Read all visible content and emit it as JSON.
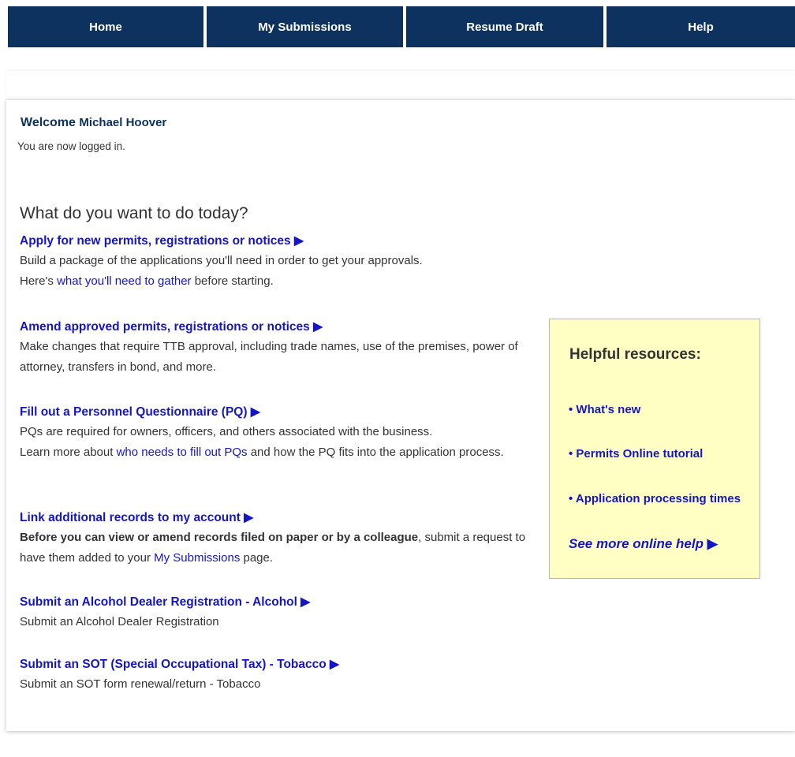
{
  "nav": {
    "home": "Home",
    "submissions": "My Submissions",
    "resume": "Resume Draft",
    "help": "Help"
  },
  "welcome": {
    "greeting": "Welcome",
    "name": "Michael Hoover",
    "status": "You are now logged in."
  },
  "headline": "What do you want to do today?",
  "arrow": "▶",
  "tasks": {
    "apply": {
      "title": "Apply for new permits, registrations or notices",
      "desc_a": "Build a package of the applications you'll need in order to get your approvals.",
      "desc_b": "Here's",
      "link": "what you'll need to gather",
      "desc_c": "before starting."
    },
    "amend": {
      "title": "Amend approved permits, registrations or notices",
      "desc": "Make changes that require TTB approval, including trade names, use of the premises, power of attorney, transfers in bond, and more."
    },
    "pq": {
      "title": "Fill out a Personnel Questionnaire (PQ)",
      "desc_a": "PQs are required for owners, officers, and others associated with the business.",
      "desc_b": "Learn more about",
      "link": "who needs to fill out PQs",
      "desc_c": "and how the PQ fits into the application process."
    },
    "link": {
      "title": "Link additional records to my account",
      "bold": "Before you can view or amend records filed on paper or by a colleague",
      "desc_a": ", submit a request to have them added to your",
      "link": "My Submissions",
      "desc_b": "page."
    },
    "dealer": {
      "title": "Submit an Alcohol Dealer Registration - Alcohol",
      "desc": "Submit an Alcohol Dealer Registration"
    },
    "sot": {
      "title": "Submit an SOT (Special Occupational Tax) - Tobacco",
      "desc": "Submit an SOT form renewal/return - Tobacco"
    }
  },
  "resources": {
    "title": "Helpful resources:",
    "items": [
      "• What's new",
      "• Permits Online tutorial",
      "• Application processing times"
    ],
    "more": "See more online help"
  }
}
